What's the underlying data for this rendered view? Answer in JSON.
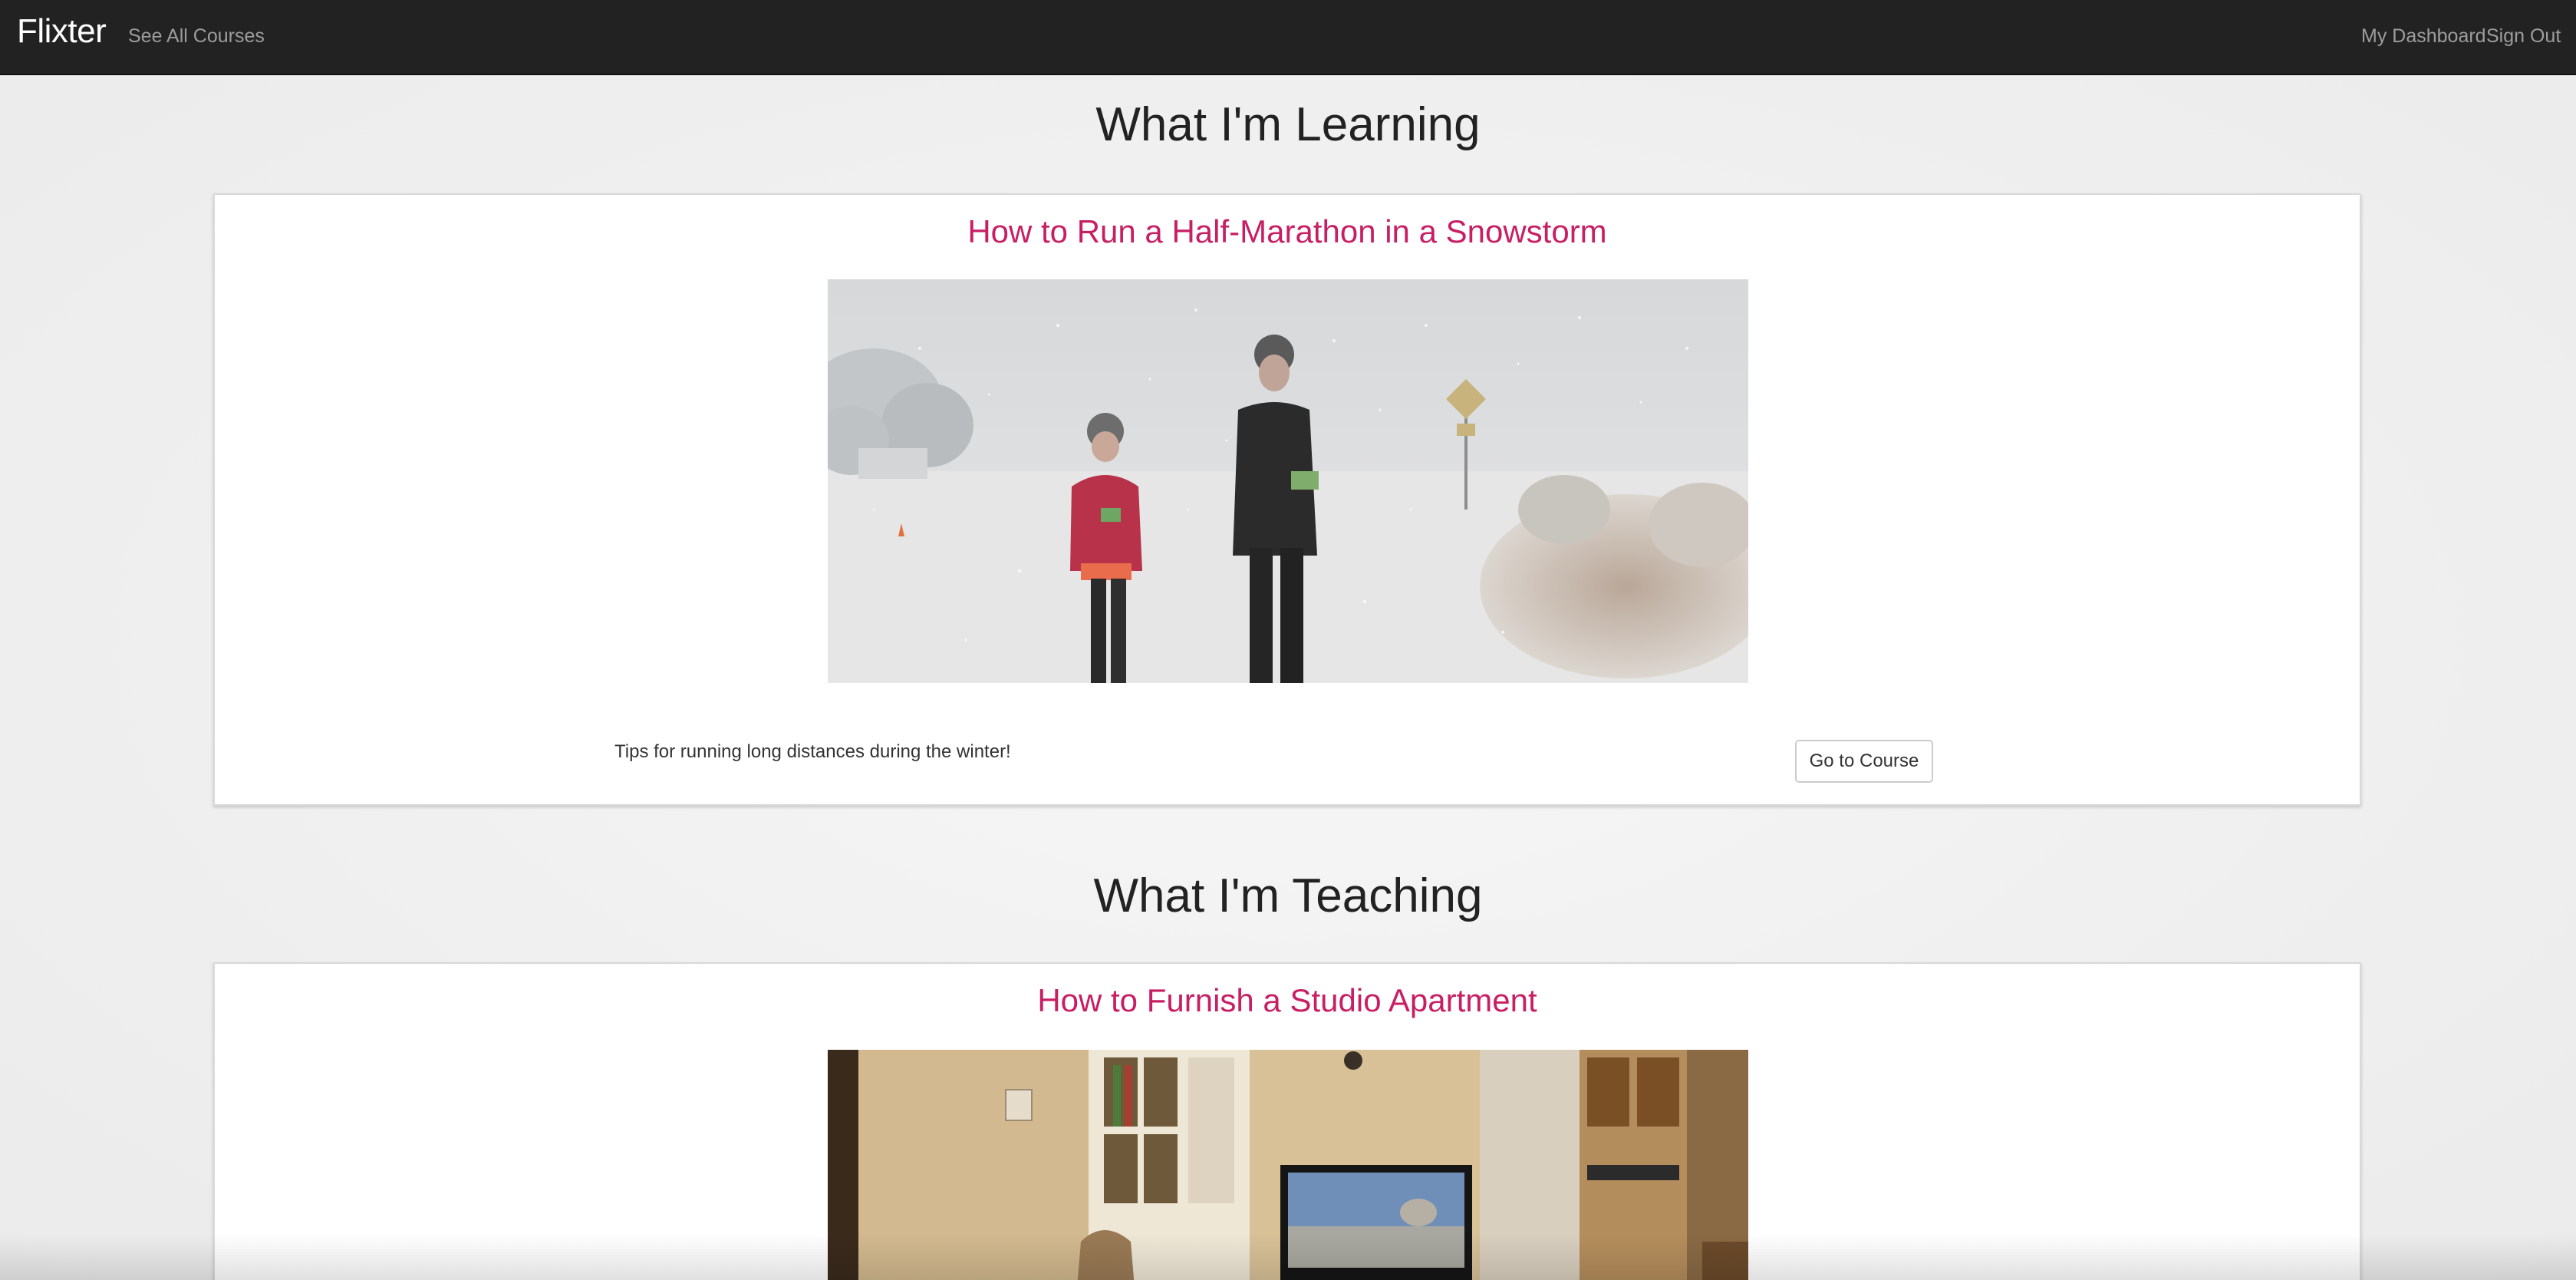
{
  "navbar": {
    "brand": "Flixter",
    "links": {
      "see_all_courses": "See All Courses",
      "my_dashboard": "My Dashboard",
      "sign_out": "Sign Out"
    }
  },
  "learning": {
    "heading": "What I'm Learning",
    "course": {
      "title": "How to Run a Half-Marathon in a Snowstorm",
      "description": "Tips for running long distances during the winter!",
      "button_label": "Go to Course"
    }
  },
  "teaching": {
    "heading": "What I'm Teaching",
    "course": {
      "title": "How to Furnish a Studio Apartment"
    }
  },
  "colors": {
    "navbar_bg": "#222222",
    "nav_link": "#9d9d9d",
    "course_title": "#c81e64",
    "page_bg": "#f2f2f2"
  }
}
